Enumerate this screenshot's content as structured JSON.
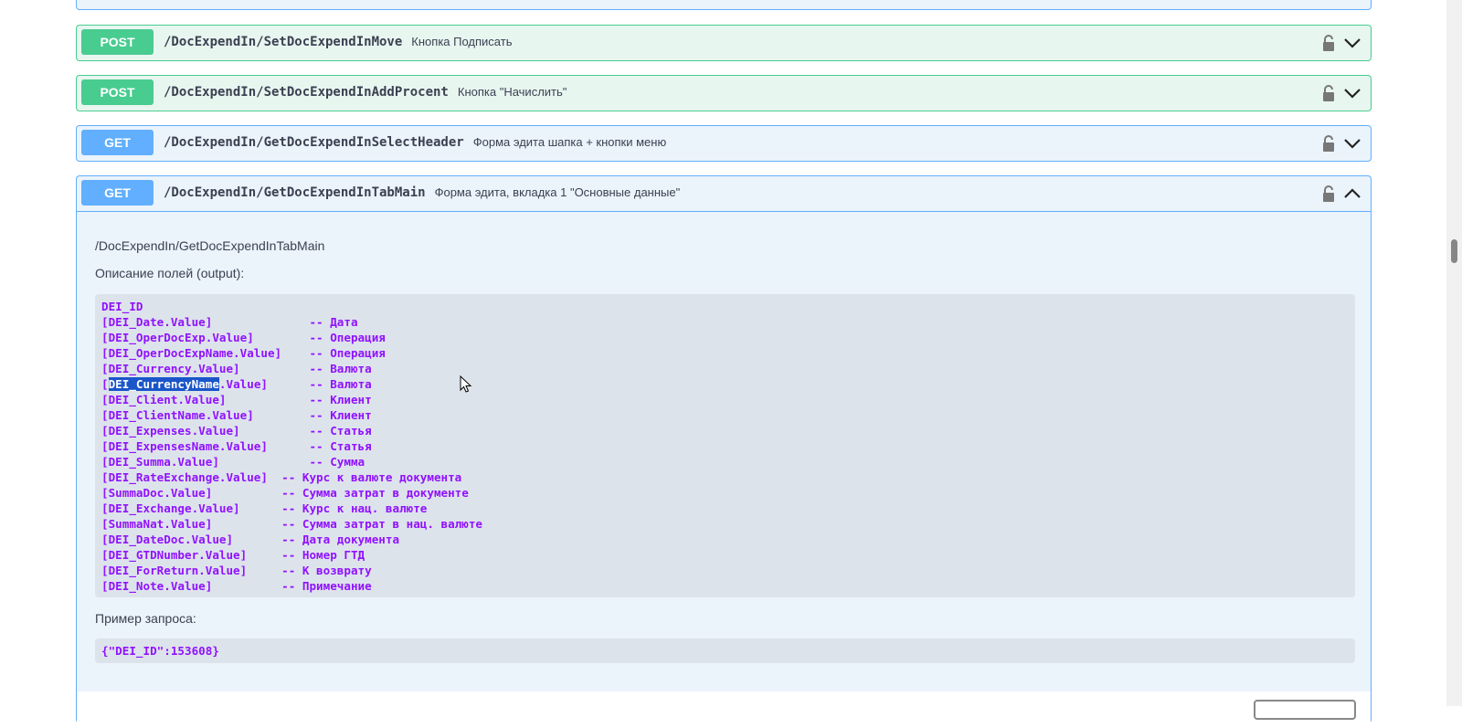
{
  "operations": [
    {
      "method": "POST",
      "path": "/DocExpendIn/SetDocExpendInMove",
      "description": "Кнопка Подписать"
    },
    {
      "method": "POST",
      "path": "/DocExpendIn/SetDocExpendInAddProcent",
      "description": "Кнопка \"Начислить\""
    },
    {
      "method": "GET",
      "path": "/DocExpendIn/GetDocExpendInSelectHeader",
      "description": "Форма эдита шапка + кнопки меню"
    },
    {
      "method": "GET",
      "path": "/DocExpendIn/GetDocExpendInTabMain",
      "description": "Форма эдита, вкладка 1 \"Основные данные\""
    }
  ],
  "expanded": {
    "endpoint_text": "/DocExpendIn/GetDocExpendInTabMain",
    "fields_heading": "Описание полей (output):",
    "code_first": "DEI_ID\n[DEI_Date.Value]              -- Дата\n[DEI_OperDocExp.Value]        -- Операция\n[DEI_OperDocExpName.Value]    -- Операция\n[DEI_Currency.Value]          -- Валюта\n[",
    "code_selected": "DEI_CurrencyName",
    "code_rest": ".Value]      -- Валюта\n[DEI_Client.Value]            -- Клиент\n[DEI_ClientName.Value]        -- Клиент\n[DEI_Expenses.Value]          -- Статья\n[DEI_ExpensesName.Value]      -- Статья\n[DEI_Summa.Value]             -- Сумма\n[DEI_RateExchange.Value]  -- Курс к валюте документа\n[SummaDoc.Value]          -- Сумма затрат в документе\n[DEI_Exchange.Value]      -- Курс к нац. валюте\n[SummaNat.Value]          -- Сумма затрат в нац. валюте\n[DEI_DateDoc.Value]       -- Дата документа\n[DEI_GTDNumber.Value]     -- Номер ГТД\n[DEI_ForReturn.Value]     -- К возврату\n[DEI_Note.Value]          -- Примечание",
    "example_heading": "Пример запроса:",
    "example_code": "{\"DEI_ID\":153608}"
  },
  "colors": {
    "post": "#49cc90",
    "get": "#61affe",
    "code_text": "#9012fe"
  },
  "icons": {
    "lock": "lock-icon",
    "chevron_down": "chevron-down-icon",
    "chevron_up": "chevron-up-icon"
  }
}
